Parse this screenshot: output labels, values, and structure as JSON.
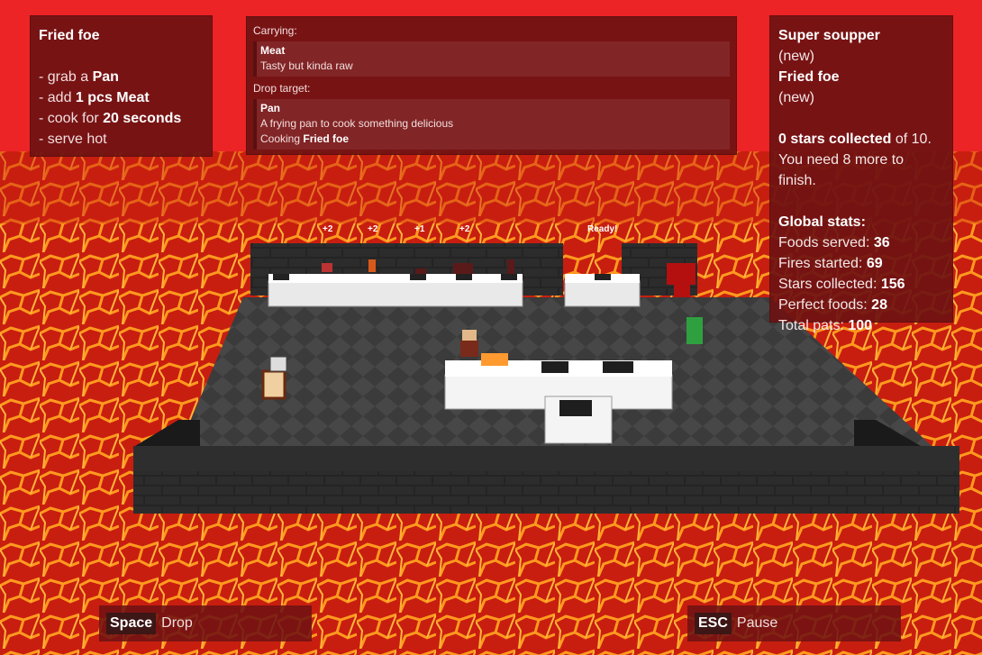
{
  "recipe": {
    "title": "Fried foe",
    "steps": [
      {
        "pre": "- grab a ",
        "bold": "Pan",
        "post": ""
      },
      {
        "pre": "- add ",
        "bold": "1 pcs Meat",
        "post": ""
      },
      {
        "pre": "- cook for ",
        "bold": "20 seconds",
        "post": ""
      },
      {
        "pre": "- serve hot",
        "bold": "",
        "post": ""
      }
    ]
  },
  "info": {
    "carrying_label": "Carrying:",
    "carrying_name": "Meat",
    "carrying_desc": "Tasty but kinda raw",
    "drop_label": "Drop target:",
    "drop_name": "Pan",
    "drop_desc": "A frying pan to cook something delicious",
    "cooking_prefix": "Cooking ",
    "cooking_item": "Fried foe"
  },
  "stats": {
    "recipes": [
      {
        "name": "Super soupper",
        "status": "(new)"
      },
      {
        "name": "Fried foe",
        "status": "(new)"
      }
    ],
    "stars_bold": "0 stars collected",
    "stars_rest": " of 10.",
    "need_text": "You need 8 more to finish.",
    "global_title": "Global stats:",
    "rows": [
      {
        "label": "Foods served: ",
        "value": "36"
      },
      {
        "label": "Fires started: ",
        "value": "69"
      },
      {
        "label": "Stars collected: ",
        "value": "156"
      },
      {
        "label": "Perfect foods: ",
        "value": "28"
      },
      {
        "label": "Total pats: ",
        "value": "100"
      }
    ]
  },
  "bubbles": [
    "+2",
    "+2",
    "+1",
    "+2",
    "Ready!"
  ],
  "keys": {
    "drop_key": "Space",
    "drop_label": "Drop",
    "pause_key": "ESC",
    "pause_label": "Pause"
  },
  "colors": {
    "lava": "#c8190f",
    "panel": "#6e1212",
    "floor": "#3a3a3a",
    "wall": "#1f1f1f"
  }
}
